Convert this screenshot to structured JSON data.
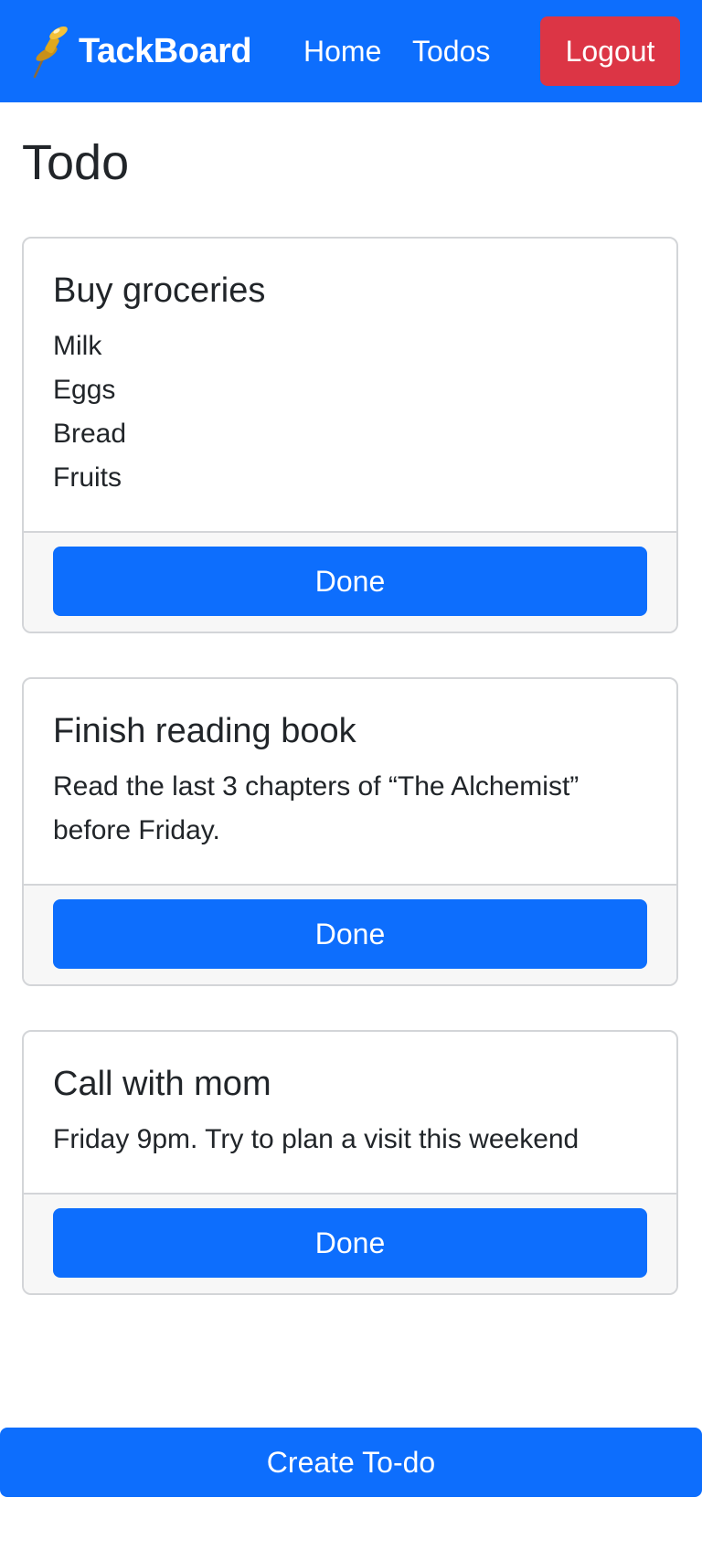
{
  "navbar": {
    "brand": "TackBoard",
    "brand_icon": "pushpin-icon",
    "links": [
      "Home",
      "Todos"
    ],
    "logout_label": "Logout",
    "colors": {
      "bar": "#0d6efd",
      "logout": "#dc3545"
    }
  },
  "page": {
    "title": "Todo"
  },
  "todos": [
    {
      "title": "Buy groceries",
      "lines": [
        "Milk",
        "Eggs",
        "Bread",
        "Fruits"
      ],
      "done_label": "Done"
    },
    {
      "title": "Finish reading book",
      "lines": [
        "Read the last 3 chapters of “The Alchemist”",
        "before Friday."
      ],
      "done_label": "Done"
    },
    {
      "title": "Call with mom",
      "lines": [
        "Friday 9pm. Try to plan a visit this weekend"
      ],
      "done_label": "Done"
    }
  ],
  "create_label": "Create To-do"
}
